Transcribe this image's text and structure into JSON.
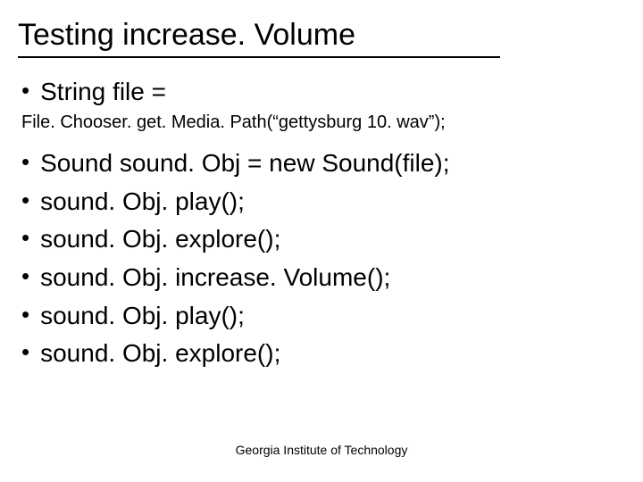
{
  "title": "Testing increase. Volume",
  "line1": "String file =",
  "code": "File. Chooser. get. Media. Path(“gettysburg 10. wav”);",
  "items": [
    "Sound sound. Obj = new Sound(file);",
    "sound. Obj. play();",
    "sound. Obj. explore();",
    "sound. Obj. increase. Volume();",
    "sound. Obj. play();",
    "sound. Obj. explore();"
  ],
  "footer": "Georgia Institute of Technology"
}
